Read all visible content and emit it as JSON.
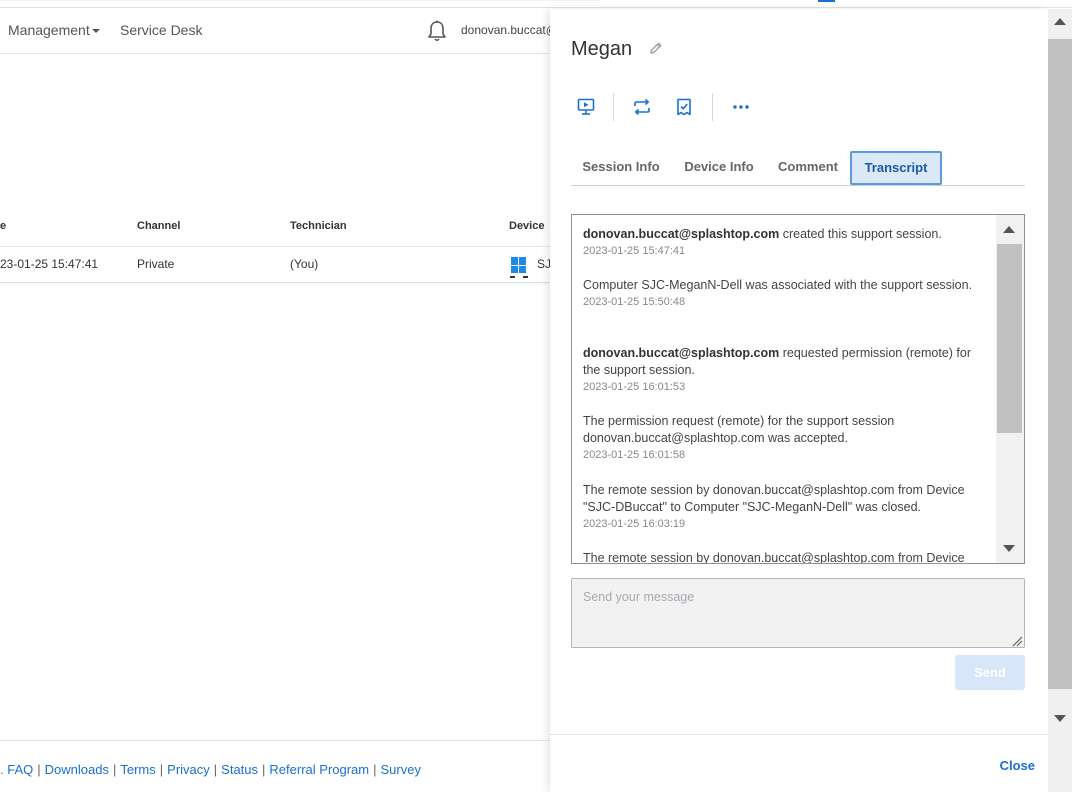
{
  "nav": {
    "management_label": "Management",
    "service_desk_label": "Service Desk",
    "user_label": "donovan.buccat@splashtop.com",
    "notification_icon": "bell-icon"
  },
  "table": {
    "headers": [
      "e",
      "Channel",
      "Technician",
      "Device"
    ],
    "rows": [
      {
        "time": "23-01-25 15:47:41",
        "channel": "Private",
        "technician": "(You)",
        "device": "SJ",
        "device_icon": "windows-icon"
      }
    ]
  },
  "footer": {
    "prefix": ".",
    "links": [
      "FAQ",
      "Downloads",
      "Terms",
      "Privacy",
      "Status",
      "Referral Program",
      "Survey"
    ]
  },
  "drawer": {
    "title": "Megan",
    "edit_icon": "pencil-icon",
    "actions": [
      {
        "icon": "remote-connect-icon"
      },
      {
        "icon": "transfer-icon"
      },
      {
        "icon": "close-session-icon"
      },
      {
        "icon": "more-icon"
      }
    ],
    "tabs": [
      {
        "label": "Session Info",
        "active": false
      },
      {
        "label": "Device Info",
        "active": false
      },
      {
        "label": "Comment",
        "active": false
      },
      {
        "label": "Transcript",
        "active": true
      }
    ],
    "transcript": [
      {
        "actor": "donovan.buccat@splashtop.com",
        "text": " created this support session.",
        "time": "2023-01-25 15:47:41"
      },
      {
        "actor": "",
        "text": "Computer SJC-MeganN-Dell was associated with the support session.",
        "time": "2023-01-25 15:50:48"
      },
      {
        "actor": "donovan.buccat@splashtop.com",
        "text": " requested permission (remote) for the support session.",
        "time": "2023-01-25 16:01:53"
      },
      {
        "actor": "",
        "text": "The permission request (remote) for the support session donovan.buccat@splashtop.com was accepted.",
        "time": "2023-01-25 16:01:58"
      },
      {
        "actor": "",
        "text": "The remote session by donovan.buccat@splashtop.com from Device \"SJC-DBuccat\" to Computer \"SJC-MeganN-Dell\" was closed.",
        "time": "2023-01-25 16:03:19"
      },
      {
        "actor": "",
        "text": "The remote session by donovan.buccat@splashtop.com from Device",
        "time": ""
      }
    ],
    "message_placeholder": "Send your message",
    "send_label": "Send",
    "close_label": "Close"
  },
  "colors": {
    "accent": "#1a6fd1",
    "tab_active_bg": "#dbe8f6",
    "send_disabled_bg": "#d7e6f9"
  }
}
